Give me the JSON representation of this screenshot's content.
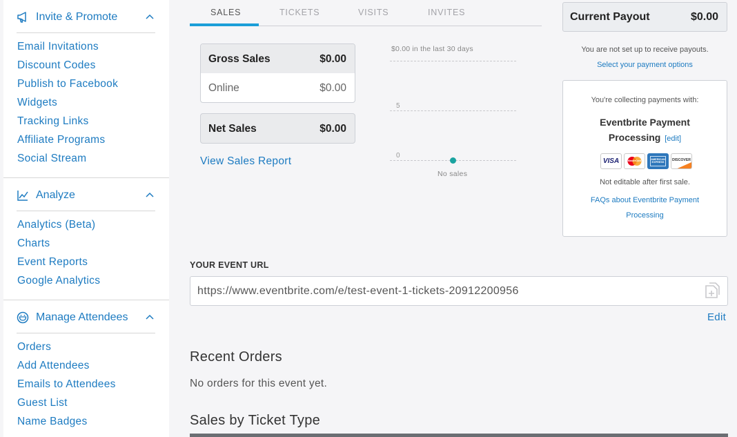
{
  "sidebar": {
    "sections": [
      {
        "title": "Invite & Promote",
        "items": [
          "Email Invitations",
          "Discount Codes",
          "Publish to Facebook",
          "Widgets",
          "Tracking Links",
          "Affiliate Programs",
          "Social Stream"
        ]
      },
      {
        "title": "Analyze",
        "items": [
          "Analytics (Beta)",
          "Charts",
          "Event Reports",
          "Google Analytics"
        ]
      },
      {
        "title": "Manage Attendees",
        "items": [
          "Orders",
          "Add Attendees",
          "Emails to Attendees",
          "Guest List",
          "Name Badges"
        ]
      }
    ]
  },
  "tabs": [
    "SALES",
    "TICKETS",
    "VISITS",
    "INVITES"
  ],
  "active_tab": "SALES",
  "sales": {
    "gross_label": "Gross Sales",
    "gross_value": "$0.00",
    "online_label": "Online",
    "online_value": "$0.00",
    "net_label": "Net Sales",
    "net_value": "$0.00",
    "report_link": "View Sales Report"
  },
  "chart_data": {
    "type": "line",
    "title": "$0.00 in the last 30 days",
    "y_ticks": [
      "0",
      "5"
    ],
    "x": [
      ""
    ],
    "series": [
      {
        "values": [
          0
        ]
      }
    ],
    "annotation": "No sales",
    "ylim": [
      0,
      10
    ],
    "grid": true,
    "color": "#1aa3a0"
  },
  "payout": {
    "label": "Current Payout",
    "value": "$0.00",
    "notice": "You are not set up to receive payouts.",
    "link": "Select your payment options"
  },
  "payments": {
    "intro": "You're collecting payments with:",
    "provider_line1": "Eventbrite Payment",
    "provider_line2": "Processing",
    "edit_link": "[edit]",
    "cards": [
      {
        "name": "VISA",
        "icon": "visa-card-icon"
      },
      {
        "name": "MasterCard",
        "icon": "mastercard-card-icon"
      },
      {
        "name": "AMERICAN EXPRESS",
        "icon": "amex-card-icon"
      },
      {
        "name": "DISCOVER",
        "icon": "discover-card-icon"
      }
    ],
    "note": "Not editable after first sale.",
    "faq_line1": "FAQs about Eventbrite Payment",
    "faq_line2": "Processing"
  },
  "event_url": {
    "label": "YOUR EVENT URL",
    "value": "https://www.eventbrite.com/e/test-event-1-tickets-20912200956",
    "edit": "Edit"
  },
  "recent_orders": {
    "title": "Recent Orders",
    "empty": "No orders for this event yet."
  },
  "ticket_type": {
    "title": "Sales by Ticket Type"
  },
  "colors": {
    "link": "#1d7bc1",
    "accent": "#1b9ed8",
    "chart_point": "#1aa3a0"
  }
}
